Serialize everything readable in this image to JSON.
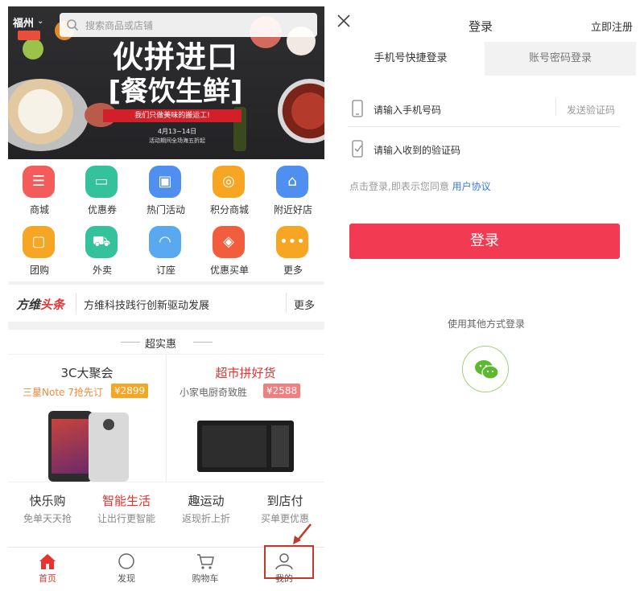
{
  "left": {
    "city": "福州",
    "search_placeholder": "搜索商品或店铺",
    "banner": {
      "headline1": "伙拼进口",
      "headline2": "[餐饮生鲜]",
      "tagline": "我们只做美味的搬运工!",
      "date": "4月13~14日",
      "promo": "活动期间全场海五折起"
    },
    "grid": [
      {
        "label": "商城",
        "color": "#f45b5b"
      },
      {
        "label": "优惠券",
        "color": "#33c29a"
      },
      {
        "label": "热门活动",
        "color": "#4f8ff0"
      },
      {
        "label": "积分商城",
        "color": "#f6a623"
      },
      {
        "label": "附近好店",
        "color": "#4f8ff0"
      },
      {
        "label": "团购",
        "color": "#f6a623"
      },
      {
        "label": "外卖",
        "color": "#33c29a"
      },
      {
        "label": "订座",
        "color": "#5aa9f0"
      },
      {
        "label": "优惠买单",
        "color": "#f25e3d"
      },
      {
        "label": "更多",
        "color": "#f6a623"
      }
    ],
    "news": {
      "logo_a": "方维",
      "logo_b": "头条",
      "text": "方维科技践行创新驱动发展",
      "more": "更多"
    },
    "deal_title": "超实惠",
    "products": [
      {
        "title": "3C大聚会",
        "sub": "三星Note 7抢先订",
        "price": "¥2899"
      },
      {
        "title": "超市拼好货",
        "sub": "小家电厨奇致胜",
        "price": "¥2588"
      }
    ],
    "categories": [
      {
        "title": "快乐购",
        "sub": "免单天天抢"
      },
      {
        "title": "智能生活",
        "sub": "让出行更智能"
      },
      {
        "title": "趣运动",
        "sub": "返现折上折"
      },
      {
        "title": "到店付",
        "sub": "买单更优惠"
      }
    ],
    "tabs": [
      {
        "label": "首页"
      },
      {
        "label": "发现"
      },
      {
        "label": "购物车"
      },
      {
        "label": "我的"
      }
    ]
  },
  "right": {
    "title": "登录",
    "register": "立即注册",
    "tab_phone": "手机号快捷登录",
    "tab_account": "账号密码登录",
    "phone_placeholder": "请输入手机号码",
    "send_code": "发送验证码",
    "code_placeholder": "请输入收到的验证码",
    "agree_text": "点击登录,即表示您同意",
    "agree_link": "用户协议",
    "login_button": "登录",
    "other_login": "使用其他方式登录"
  },
  "colors": {
    "accent_red": "#e8322e",
    "login_button": "#f23a52",
    "link_blue": "#3b79d7",
    "wechat_green": "#5cb82e"
  }
}
